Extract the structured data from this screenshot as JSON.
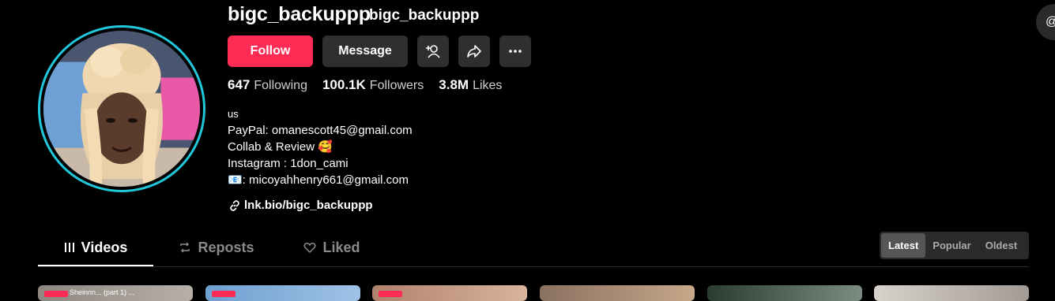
{
  "profile": {
    "username": "bigc_backuppp",
    "nickname": "bigc_backuppp",
    "ring_color": "#21c8dc"
  },
  "actions": {
    "follow": "Follow",
    "message": "Message",
    "follow_color": "#fe2c55",
    "icons": [
      "add-user-icon",
      "share-icon",
      "more-icon"
    ]
  },
  "stats": {
    "following": {
      "count": "647",
      "label": "Following"
    },
    "followers": {
      "count": "100.1K",
      "label": "Followers"
    },
    "likes": {
      "count": "3.8M",
      "label": "Likes"
    }
  },
  "bio": {
    "line1": "us",
    "line2": "PayPal: omanescott45@gmail.com",
    "line3": "Collab & Review 🥰",
    "line4": "Instagram : 1don_cami",
    "line5": "📧: micoyahhenry661@gmail.com"
  },
  "link": {
    "text": "lnk.bio/bigc_backuppp"
  },
  "tabs": [
    {
      "label": "Videos",
      "active": true
    },
    {
      "label": "Reposts",
      "active": false
    },
    {
      "label": "Liked",
      "active": false
    }
  ],
  "sort": {
    "options": [
      "Latest",
      "Popular",
      "Oldest"
    ],
    "selected": "Latest"
  },
  "thumbnails": {
    "caption_1": "Sheinnn... (part 1) ..."
  }
}
